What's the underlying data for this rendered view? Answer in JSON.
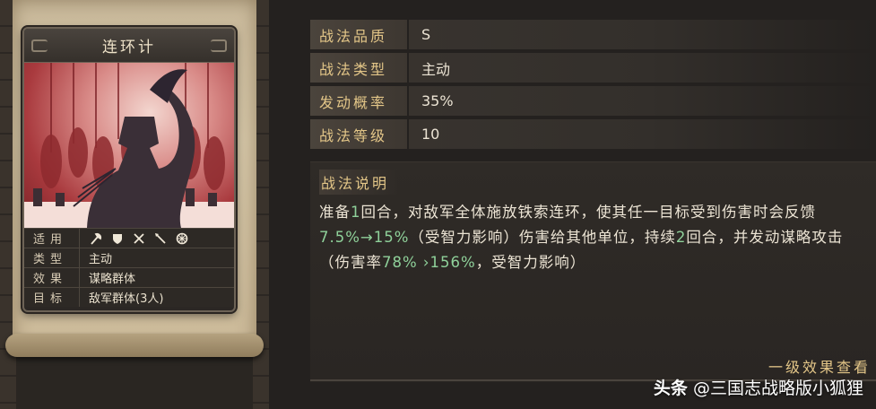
{
  "card": {
    "title": "连环计",
    "rows": [
      {
        "key": "适用",
        "icons": [
          "axe-icon",
          "shield-icon",
          "crossed-swords-icon",
          "spear-icon",
          "wheel-icon"
        ]
      },
      {
        "key": "类型",
        "value": "主动"
      },
      {
        "key": "效果",
        "value": "谋略群体"
      },
      {
        "key": "目标",
        "value": "敌军群体(3人)"
      }
    ]
  },
  "info": [
    {
      "key": "战法品质",
      "value": "S"
    },
    {
      "key": "战法类型",
      "value": "主动"
    },
    {
      "key": "发动概率",
      "value": "35%"
    },
    {
      "key": "战法等级",
      "value": "10"
    }
  ],
  "description": {
    "title": "战法说明",
    "p1": "准备",
    "p2": "1",
    "p3": "回合，对敌军全体施放铁索连环，使其任一目标受到伤害时会反馈",
    "p4": "7.5%→15%",
    "p5": "（受智力影响）伤害给其他单位，持续",
    "p6": "2",
    "p7": "回合，并发动谋略攻击（伤害率",
    "p8": "78%",
    "p9": " ›156%",
    "p10": "，受智力影响）"
  },
  "link_label": "一级效果查看",
  "watermark": {
    "brand": "头条",
    "account": "@三国志战略版小狐狸"
  },
  "colors": {
    "accent_gold": "#e3c688",
    "highlight_green": "#8fd19a"
  }
}
